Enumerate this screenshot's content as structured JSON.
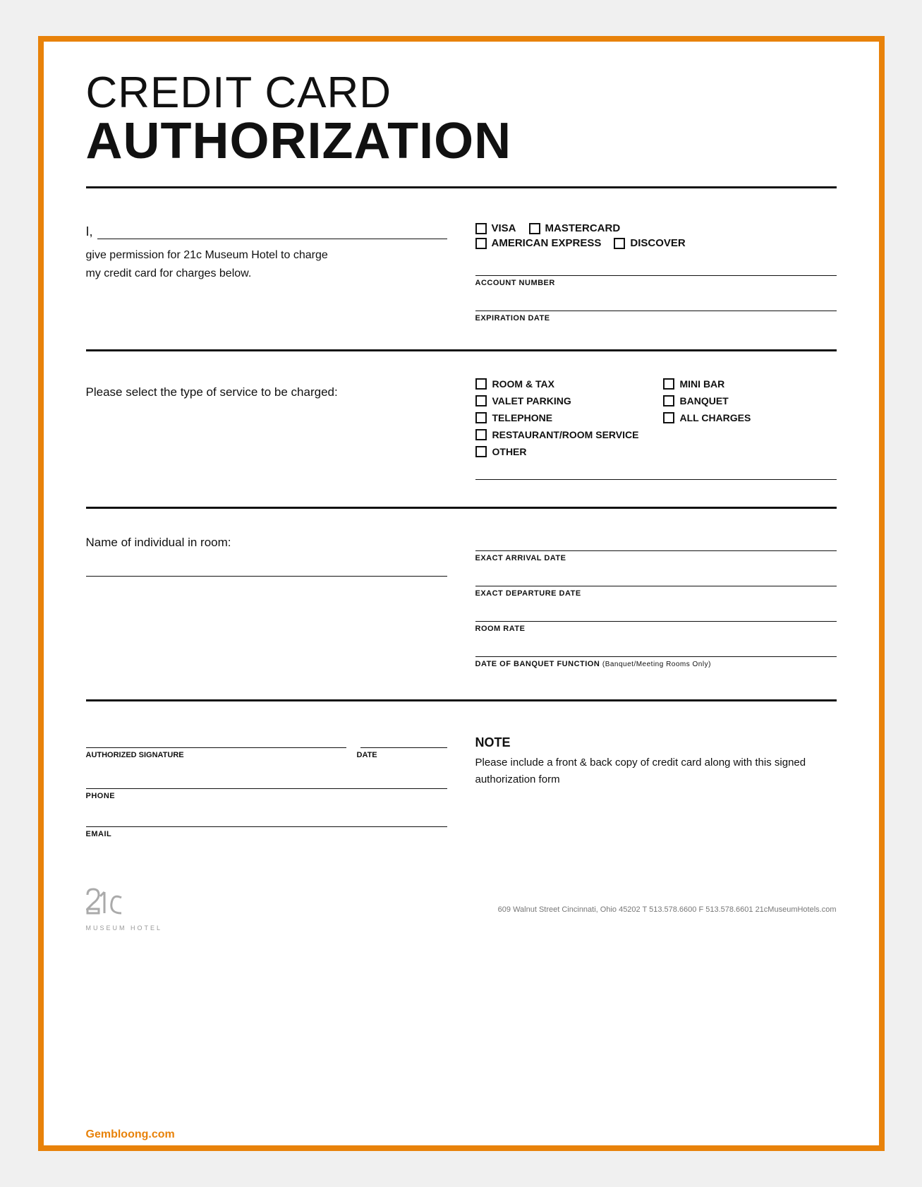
{
  "page": {
    "border_color": "#e8820a"
  },
  "header": {
    "line1": "CREDIT CARD",
    "line2": "AUTHORIZATION"
  },
  "section1": {
    "i_label": "I,",
    "permission_text_line1": "give permission for 21c Museum Hotel to charge",
    "permission_text_line2": "my credit card for charges below.",
    "card_types": [
      {
        "label": "VISA"
      },
      {
        "label": "MASTERCARD"
      },
      {
        "label": "AMERICAN EXPRESS"
      },
      {
        "label": "DISCOVER"
      }
    ],
    "account_number_label": "ACCOUNT NUMBER",
    "expiration_date_label": "EXPIRATION DATE"
  },
  "section2": {
    "prompt": "Please select the type of service to be charged:",
    "services": [
      {
        "label": "ROOM & TAX",
        "full": false
      },
      {
        "label": "MINI BAR",
        "full": false
      },
      {
        "label": "VALET PARKING",
        "full": false
      },
      {
        "label": "BANQUET",
        "full": false
      },
      {
        "label": "TELEPHONE",
        "full": false
      },
      {
        "label": "ALL CHARGES",
        "full": false
      },
      {
        "label": "RESTAURANT/ROOM SERVICE",
        "full": true
      },
      {
        "label": "OTHER",
        "full": true
      }
    ]
  },
  "section3": {
    "name_label": "Name of individual in room:",
    "fields": [
      {
        "label": "EXACT ARRIVAL DATE"
      },
      {
        "label": "EXACT DEPARTURE DATE"
      },
      {
        "label": "ROOM RATE"
      },
      {
        "label": "DATE OF BANQUET FUNCTION",
        "sublabel": "(Banquet/Meeting Rooms Only)"
      }
    ]
  },
  "section4": {
    "sig_label": "AUTHORIZED SIGNATURE",
    "date_label": "DATE",
    "phone_label": "PHONE",
    "email_label": "EMAIL",
    "note_title": "NOTE",
    "note_text": "Please include a front & back copy of credit card along with this signed authorization form"
  },
  "footer": {
    "logo_symbol": "21c",
    "logo_subtext": "MUSEUM HOTEL",
    "address": "609 Walnut Street  Cincinnati, Ohio 45202  T 513.578.6600  F 513.578.6601  21cMuseumHotels.com"
  },
  "watermark": {
    "text": "Gembloong.com"
  }
}
